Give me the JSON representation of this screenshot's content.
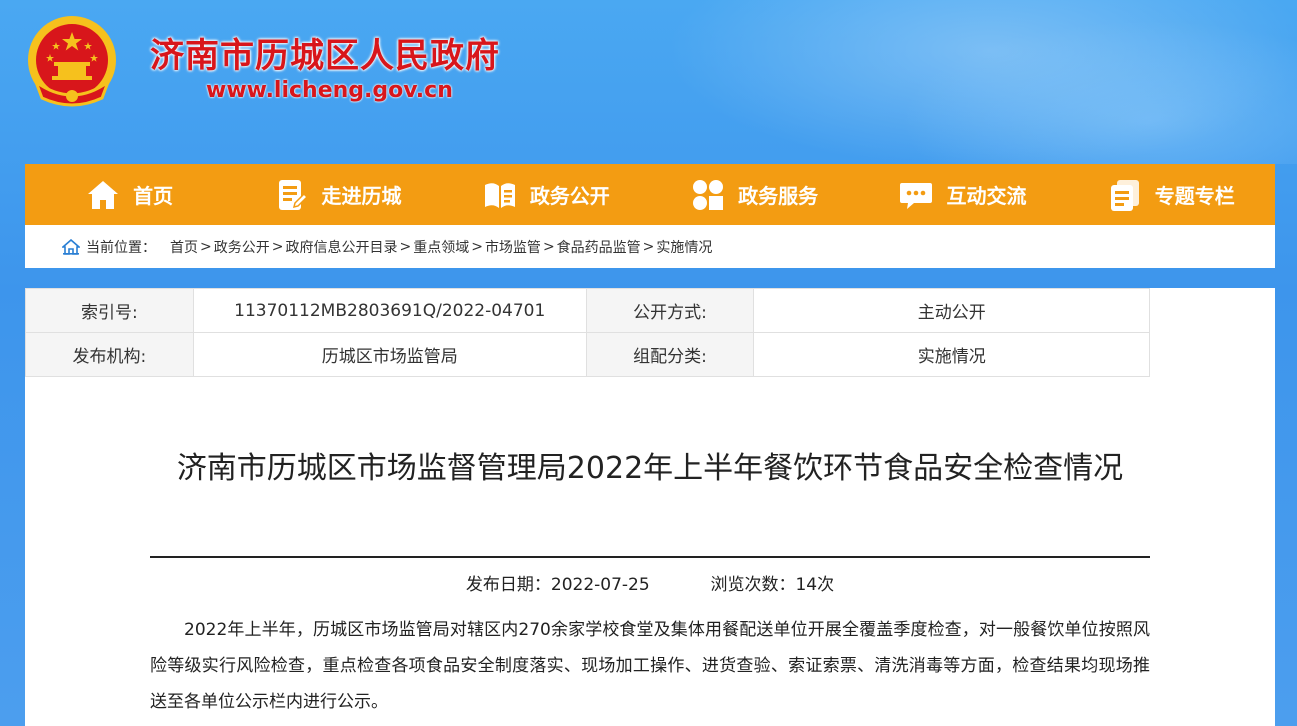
{
  "site": {
    "title": "济南市历城区人民政府",
    "url": "www.licheng.gov.cn"
  },
  "nav": [
    {
      "label": "首页",
      "icon": "home-icon"
    },
    {
      "label": "走进历城",
      "icon": "document-icon"
    },
    {
      "label": "政务公开",
      "icon": "open-book-icon"
    },
    {
      "label": "政务服务",
      "icon": "grid-icon"
    },
    {
      "label": "互动交流",
      "icon": "chat-icon"
    },
    {
      "label": "专题专栏",
      "icon": "stacked-pages-icon"
    }
  ],
  "breadcrumb": {
    "label": "当前位置：",
    "items": [
      "首页",
      "政务公开",
      "政府信息公开目录",
      "重点领域",
      "市场监管",
      "食品药品监管",
      "实施情况"
    ],
    "separator": ">"
  },
  "meta": {
    "index_key": "索引号:",
    "index_value": "11370112MB2803691Q/2022-04701",
    "mode_key": "公开方式:",
    "mode_value": "主动公开",
    "org_key": "发布机构:",
    "org_value": "历城区市场监管局",
    "category_key": "组配分类:",
    "category_value": "实施情况"
  },
  "article": {
    "title": "济南市历城区市场监督管理局2022年上半年餐饮环节食品安全检查情况",
    "date_label": "发布日期：",
    "date": "2022-07-25",
    "views_label": "浏览次数：",
    "views": "14次",
    "body": "2022年上半年，历城区市场监管局对辖区内270余家学校食堂及集体用餐配送单位开展全覆盖季度检查，对一般餐饮单位按照风险等级实行风险检查，重点检查各项食品安全制度落实、现场加工操作、进货查验、索证索票、清洗消毒等方面，检查结果均现场推送至各单位公示栏内进行公示。"
  },
  "colors": {
    "nav_bg": "#f39c12",
    "title_red": "#d8161b",
    "sky_blue": "#4aa8f2"
  }
}
